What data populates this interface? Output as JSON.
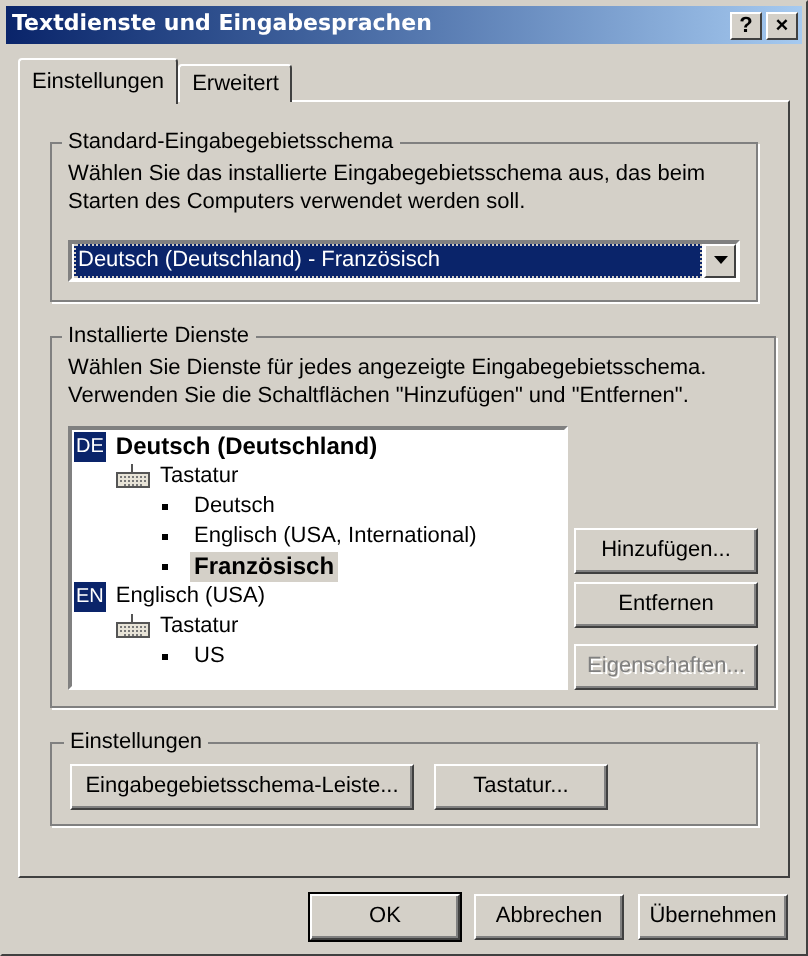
{
  "window": {
    "title": "Textdienste und Eingabesprachen",
    "title_buttons": [
      "?",
      "×"
    ]
  },
  "tabs": [
    {
      "label": "Einstellungen",
      "selected": true
    },
    {
      "label": "Erweitert",
      "selected": false
    }
  ],
  "default_group": {
    "title": "Standard-Eingabegebietsschema",
    "description": "Wählen Sie das installierte Eingabegebietsschema aus, das beim Starten des Computers verwendet werden soll.",
    "dropdown": {
      "value": "Deutsch (Deutschland) - Französisch",
      "focused": true
    }
  },
  "services_group": {
    "title": "Installierte Dienste",
    "description": "Wählen Sie Dienste für jedes angezeigte Eingabegebietsschema. Verwenden Sie die Schaltflächen \"Hinzufügen\" und \"Entfernen\".",
    "tree": [
      {
        "kind": "language",
        "badge": "DE",
        "label": "Deutsch (Deutschland)",
        "default": true,
        "selected": false,
        "children": [
          {
            "kind": "category",
            "label": "Tastatur",
            "selected": false,
            "children": [
              {
                "kind": "service",
                "label": "Deutsch",
                "selected": false
              },
              {
                "kind": "service",
                "label": "Englisch (USA, International)",
                "selected": false
              },
              {
                "kind": "service",
                "label": "Französisch",
                "selected": true
              }
            ]
          }
        ]
      },
      {
        "kind": "language",
        "badge": "EN",
        "label": "Englisch (USA)",
        "default": false,
        "selected": false,
        "children": [
          {
            "kind": "category",
            "label": "Tastatur",
            "selected": false,
            "children": [
              {
                "kind": "service",
                "label": "US",
                "selected": false
              }
            ]
          }
        ]
      }
    ],
    "buttons": [
      {
        "label": "Hinzufügen...",
        "disabled": false
      },
      {
        "label": "Entfernen",
        "disabled": false
      },
      {
        "label": "Eigenschaften...",
        "disabled": true
      }
    ]
  },
  "settings_group": {
    "title": "Einstellungen",
    "buttons": [
      {
        "label": "Eingabegebietsschema-Leiste..."
      },
      {
        "label": "Tastatur..."
      }
    ]
  },
  "footer_buttons": [
    {
      "label": "OK",
      "default": true
    },
    {
      "label": "Abbrechen",
      "default": false
    },
    {
      "label": "Übernehmen",
      "default": false
    }
  ]
}
